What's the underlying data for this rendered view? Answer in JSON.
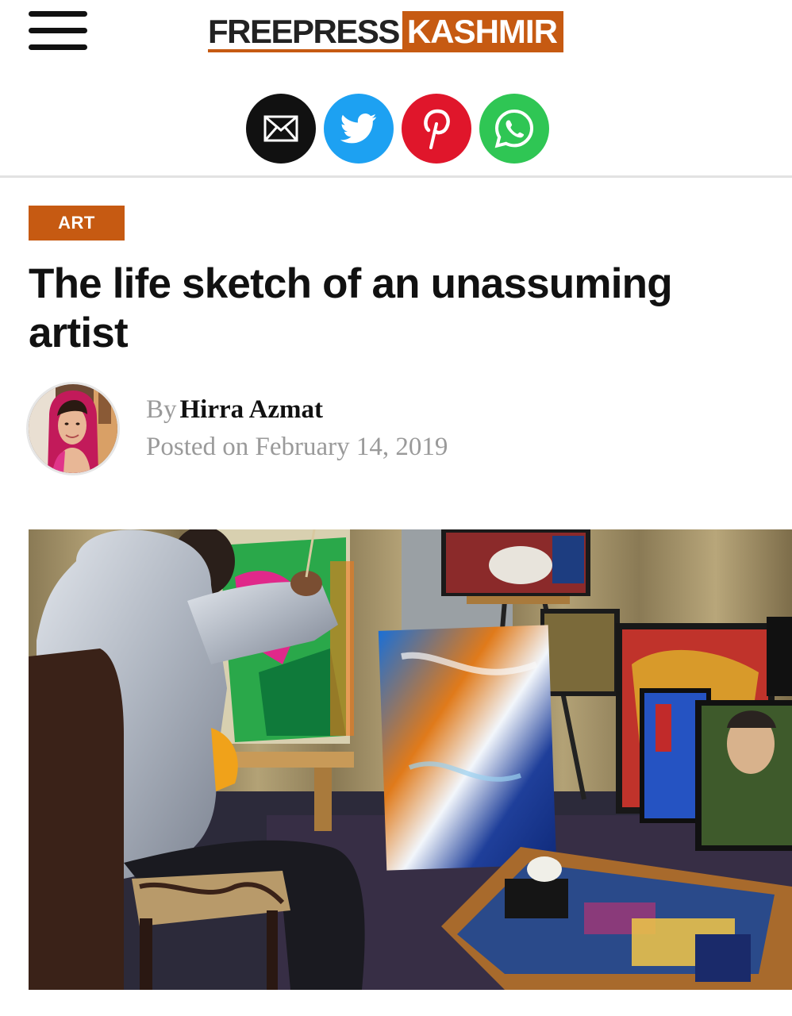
{
  "site": {
    "logo_part1": "FREEPRESS",
    "logo_part2": "KASHMIR",
    "brand_color": "#c65a12"
  },
  "header": {
    "menu_icon": "hamburger-menu-icon"
  },
  "share": {
    "buttons": [
      {
        "name": "email",
        "icon": "envelope-icon",
        "color": "#111111"
      },
      {
        "name": "twitter",
        "icon": "twitter-bird-icon",
        "color": "#1da1f2"
      },
      {
        "name": "pinterest",
        "icon": "pinterest-p-icon",
        "color": "#e0162b"
      },
      {
        "name": "whatsapp",
        "icon": "whatsapp-phone-icon",
        "color": "#2fc654"
      }
    ]
  },
  "article": {
    "category": "ART",
    "title": "The life sketch of an unassuming artist",
    "byline": {
      "prefix": "By",
      "author": "Hirra Azmat",
      "date_prefix": "Posted on",
      "date": "February 14, 2019"
    }
  }
}
